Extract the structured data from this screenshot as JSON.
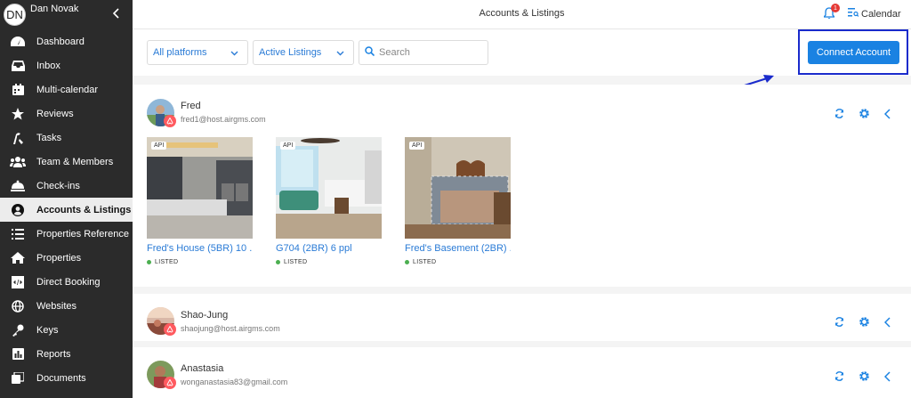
{
  "user": {
    "initials": "DN",
    "name": "Dan Novak"
  },
  "sidebar": {
    "items": [
      {
        "label": "Dashboard",
        "icon": "dashboard-icon"
      },
      {
        "label": "Inbox",
        "icon": "inbox-icon"
      },
      {
        "label": "Multi-calendar",
        "icon": "calendar-icon"
      },
      {
        "label": "Reviews",
        "icon": "star-icon"
      },
      {
        "label": "Tasks",
        "icon": "tasks-icon"
      },
      {
        "label": "Team & Members",
        "icon": "team-icon"
      },
      {
        "label": "Check-ins",
        "icon": "bell-service-icon"
      },
      {
        "label": "Accounts & Listings",
        "icon": "user-circle-icon",
        "active": true
      },
      {
        "label": "Properties Reference",
        "icon": "list-icon"
      },
      {
        "label": "Properties",
        "icon": "home-icon"
      },
      {
        "label": "Direct Booking",
        "icon": "code-icon"
      },
      {
        "label": "Websites",
        "icon": "globe-icon"
      },
      {
        "label": "Keys",
        "icon": "key-icon"
      },
      {
        "label": "Reports",
        "icon": "reports-icon"
      },
      {
        "label": "Documents",
        "icon": "documents-icon"
      }
    ]
  },
  "header": {
    "title": "Accounts & Listings",
    "notifications": "1",
    "calendar_label": "Calendar"
  },
  "filters": {
    "platform": "All platforms",
    "status": "Active Listings",
    "search_placeholder": "Search",
    "connect_label": "Connect Account"
  },
  "accounts": [
    {
      "name": "Fred",
      "email": "fred1@host.airgms.com",
      "listings": [
        {
          "tag": "API",
          "title": "Fred's House (5BR) 10 ...",
          "status": "LISTED"
        },
        {
          "tag": "API",
          "title": "G704 (2BR) 6 ppl",
          "status": "LISTED"
        },
        {
          "tag": "API",
          "title": "Fred's Basement (2BR) ...",
          "status": "LISTED"
        }
      ]
    },
    {
      "name": "Shao-Jung",
      "email": "shaojung@host.airgms.com"
    },
    {
      "name": "Anastasia",
      "email": "wonganastasia83@gmail.com"
    }
  ],
  "colors": {
    "accent": "#1a82e2",
    "link": "#2a7bd6",
    "sidebar": "#2b2b2b",
    "annotation": "#1a2bcc",
    "airbnb": "#ff5a5f",
    "listed": "#4caf50"
  }
}
